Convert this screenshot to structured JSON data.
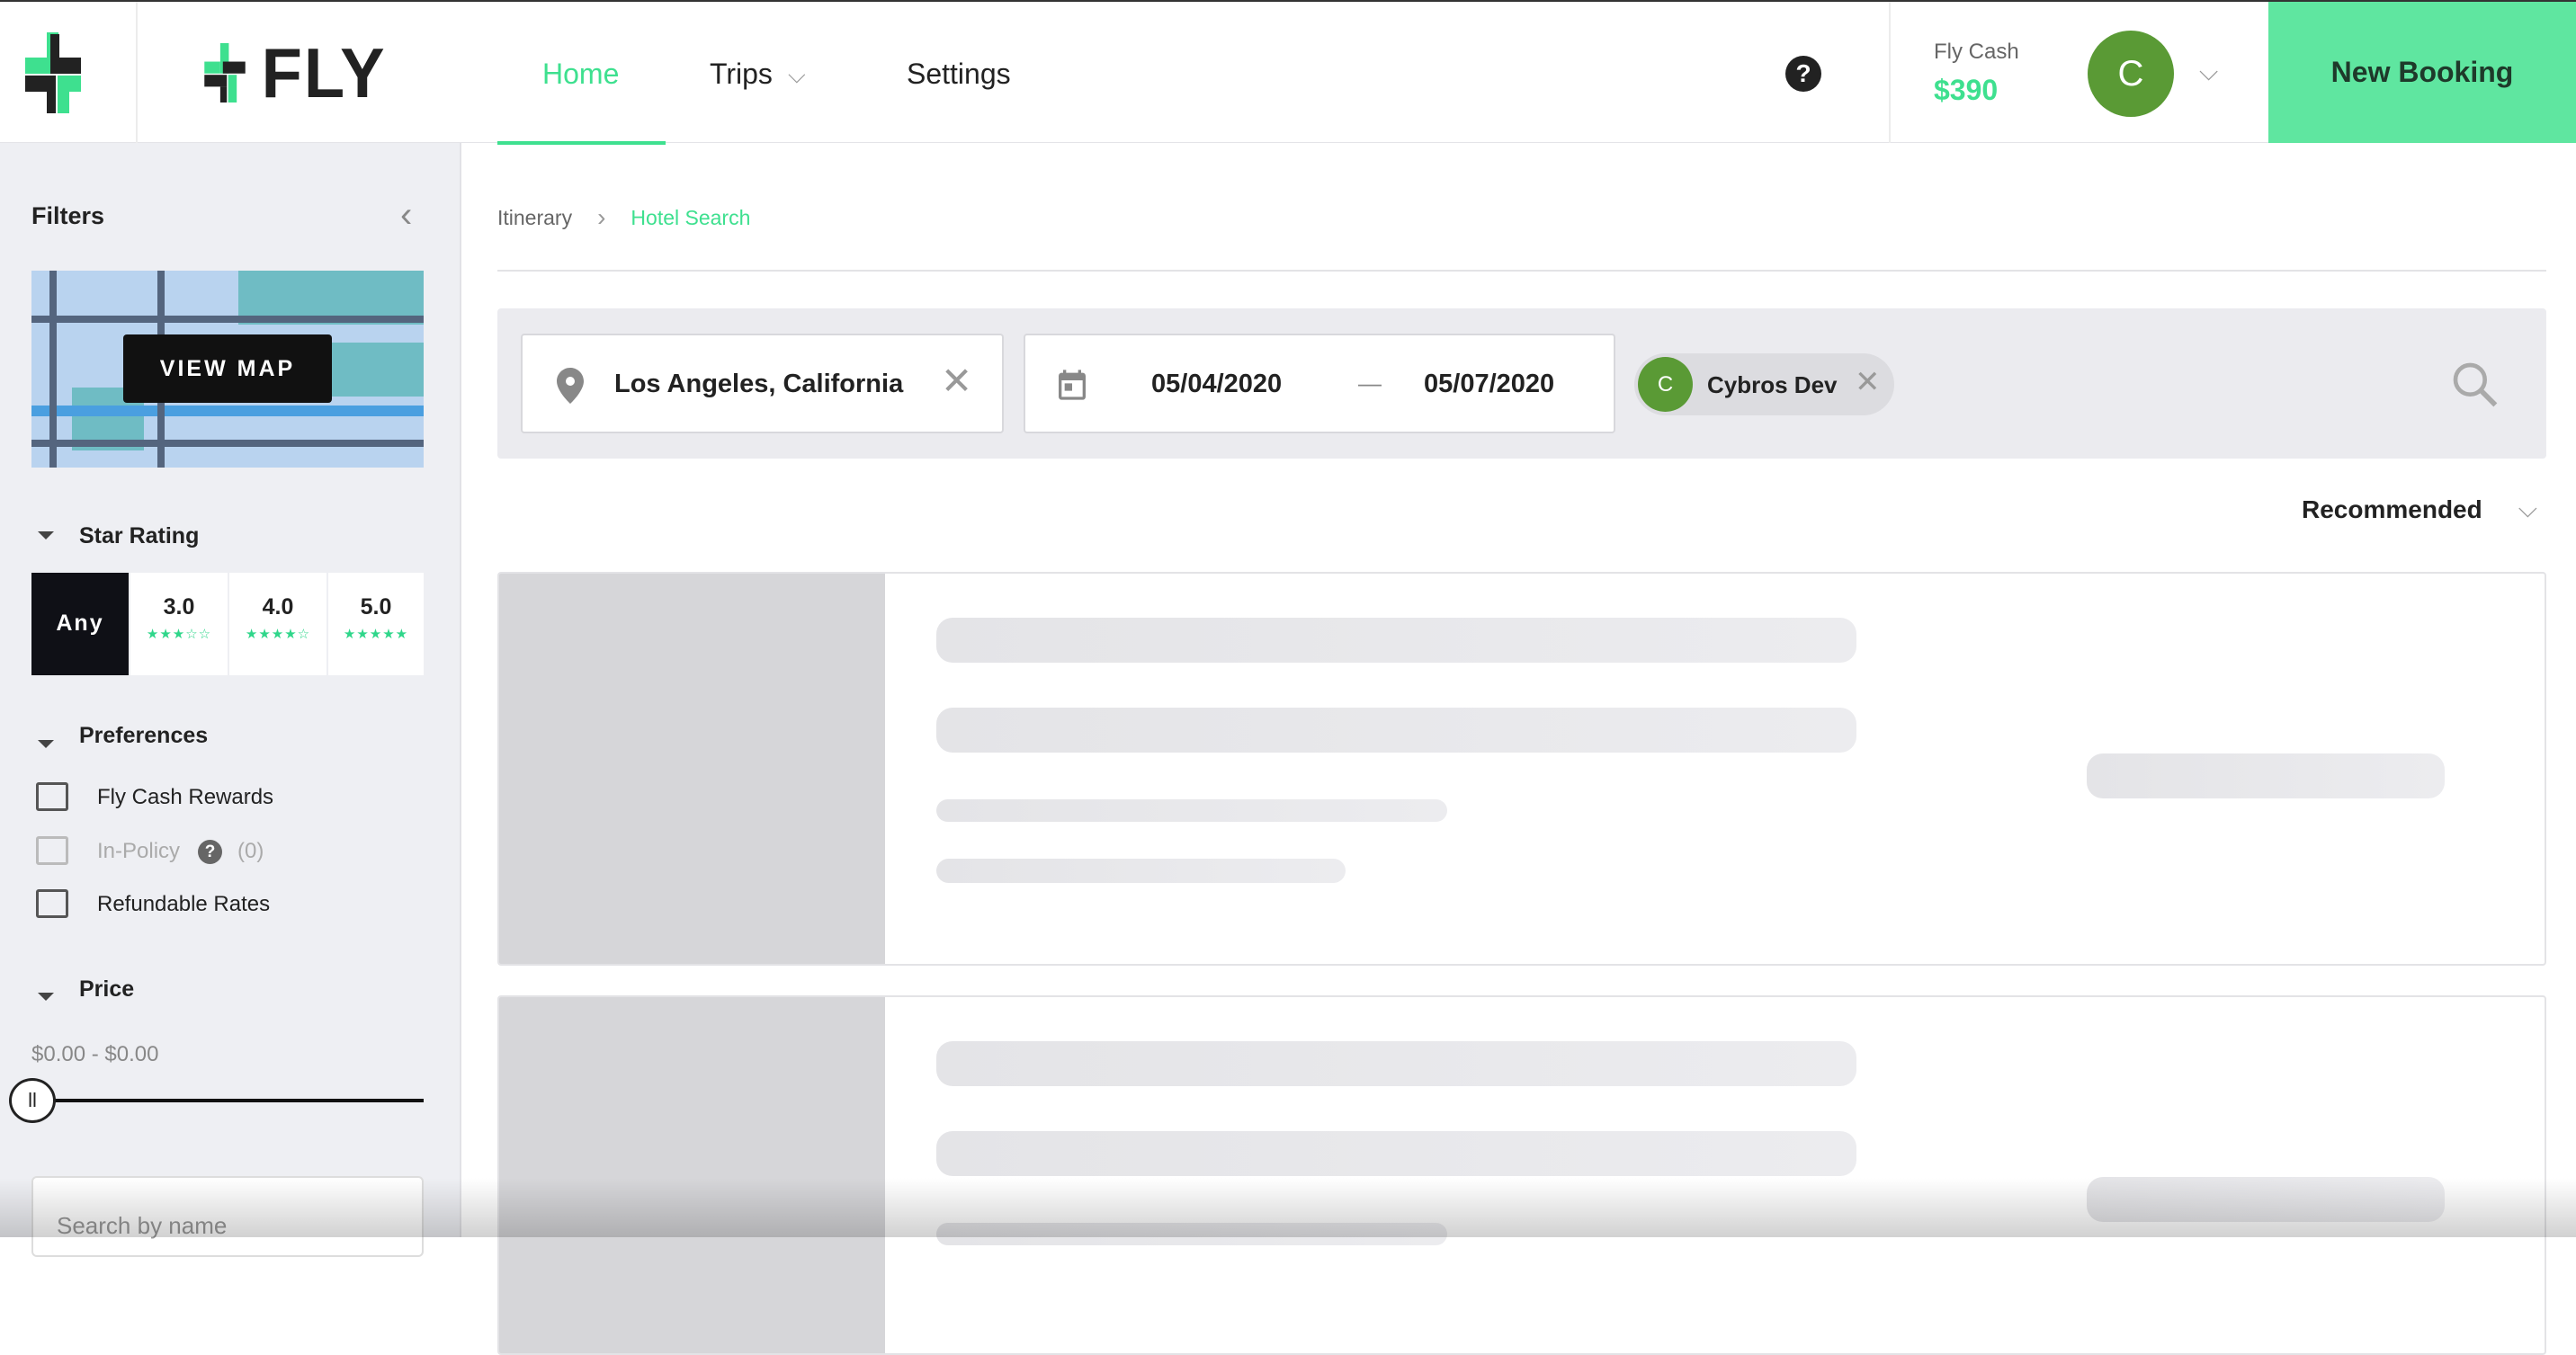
{
  "header": {
    "brand": "FLY",
    "nav": [
      {
        "label": "Home",
        "active": true
      },
      {
        "label": "Trips"
      },
      {
        "label": "Settings"
      }
    ],
    "fly_cash_label": "Fly Cash",
    "fly_cash_value": "$390",
    "avatar_initial": "C",
    "new_booking_label": "New Booking",
    "accent": "#3ee08f",
    "button_color": "#5fe6a0",
    "avatar_color": "#5a9a35"
  },
  "sidebar": {
    "title": "Filters",
    "view_map_label": "VIEW MAP",
    "star_rating": {
      "title": "Star Rating",
      "options": [
        {
          "label": "Any",
          "selected": true
        },
        {
          "label": "3.0",
          "stars": "★★★☆☆"
        },
        {
          "label": "4.0",
          "stars": "★★★★☆"
        },
        {
          "label": "5.0",
          "stars": "★★★★★"
        }
      ]
    },
    "preferences": {
      "title": "Preferences",
      "items": [
        {
          "label": "Fly Cash Rewards",
          "checked": false
        },
        {
          "label": "In-Policy",
          "count": "(0)",
          "checked": false,
          "disabled": true
        },
        {
          "label": "Refundable Rates",
          "checked": false
        }
      ]
    },
    "price": {
      "title": "Price",
      "range": "$0.00 - $0.00",
      "slider_value": 0
    },
    "search_placeholder": "Search by name"
  },
  "main": {
    "breadcrumb": [
      {
        "label": "Itinerary"
      },
      {
        "label": "Hotel Search",
        "active": true
      }
    ],
    "location": "Los Angeles, California",
    "check_in": "05/04/2020",
    "date_separator": "—",
    "check_out": "05/07/2020",
    "traveler": {
      "initial": "C",
      "name": "Cybros Dev"
    },
    "sort": "Recommended"
  }
}
